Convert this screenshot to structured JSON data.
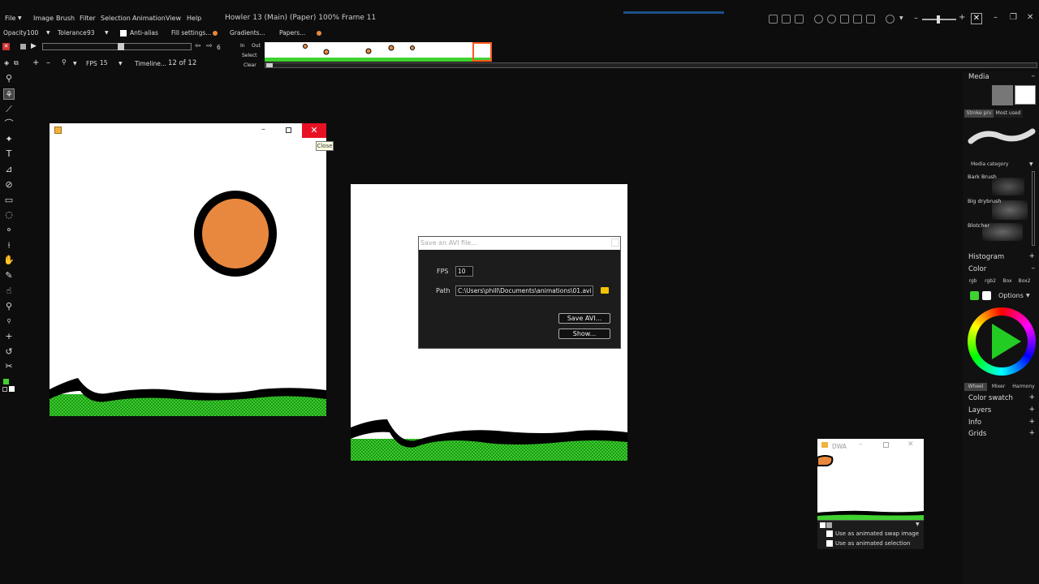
{
  "menu": [
    "File",
    "Image",
    "Brush",
    "Filter",
    "Selection",
    "Animation",
    "View",
    "Help"
  ],
  "window_title": "Howler 13 (Main) (Paper)  100%  Frame 11",
  "options_bar": {
    "opacity_label": "Opacity",
    "opacity_value": "100",
    "tolerance_label": "Tolerance",
    "tolerance_value": "93",
    "antialias_label": "Anti-alias",
    "fill_settings": "Fill settings...",
    "gradients": "Gradients...",
    "papers": "Papers..."
  },
  "anim_bar": {
    "frame_step": "6",
    "in_label": "In",
    "out_label": "Out",
    "select_label": "Select",
    "clear_label": "Clear",
    "fps_label": "FPS",
    "fps_value": "15",
    "timeline_label": "Timeline...",
    "frame_counter": "12 of 12"
  },
  "doc1": {
    "tooltip": "Close"
  },
  "dialog": {
    "title": "Save an AVI file...",
    "fps_label": "FPS",
    "fps_value": "10",
    "path_label": "Path",
    "path_value": "C:\\Users\\phill\\Documents\\animations\\01.avi",
    "save_button": "Save AVI...",
    "show_button": "Show..."
  },
  "dwa": {
    "title": "DWA",
    "option1": "Use as animated swap image",
    "option2": "Use as animated selection"
  },
  "right_panel": {
    "media": "Media",
    "tab_stroke": "Stroke prv",
    "tab_most_used": "Most used",
    "media_category": "Media category",
    "brushes": [
      "Bark Brush",
      "Big drybrush",
      "Blotcher"
    ],
    "histogram": "Histogram",
    "color": "Color",
    "color_tabs": [
      "rgb",
      "rgb2",
      "Box",
      "Box2"
    ],
    "options": "Options",
    "wheel_tabs": [
      "Wheel",
      "Mixer",
      "Harmony"
    ],
    "color_swatch": "Color swatch",
    "layers": "Layers",
    "info": "Info",
    "grids": "Grids"
  },
  "colors": {
    "accent_red": "#e81123",
    "sun_orange": "#e8883e",
    "grass_green": "#3fd12f",
    "selected_frame": "#ff5a1f",
    "tooltip_bg": "#ffffe1"
  }
}
